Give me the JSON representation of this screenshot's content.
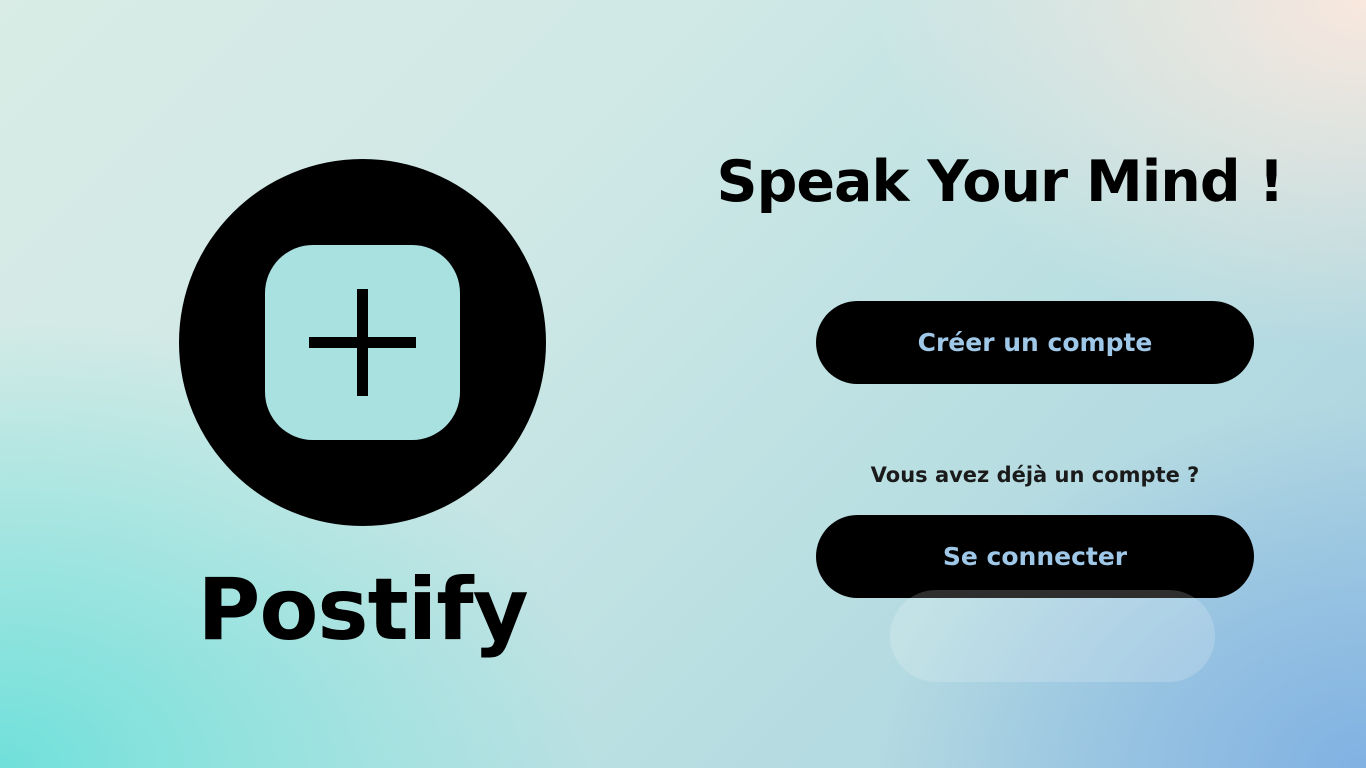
{
  "brand": {
    "name": "Postify",
    "logo_icon": "plus-square-circle-icon"
  },
  "hero": {
    "headline": "Speak Your Mind !"
  },
  "actions": {
    "create_account_label": "Créer un compte",
    "already_have_account_text": "Vous avez déjà un compte ?",
    "login_label": "Se connecter"
  },
  "colors": {
    "button_bg": "#000000",
    "button_text": "#9fc8e8",
    "text": "#000000"
  }
}
